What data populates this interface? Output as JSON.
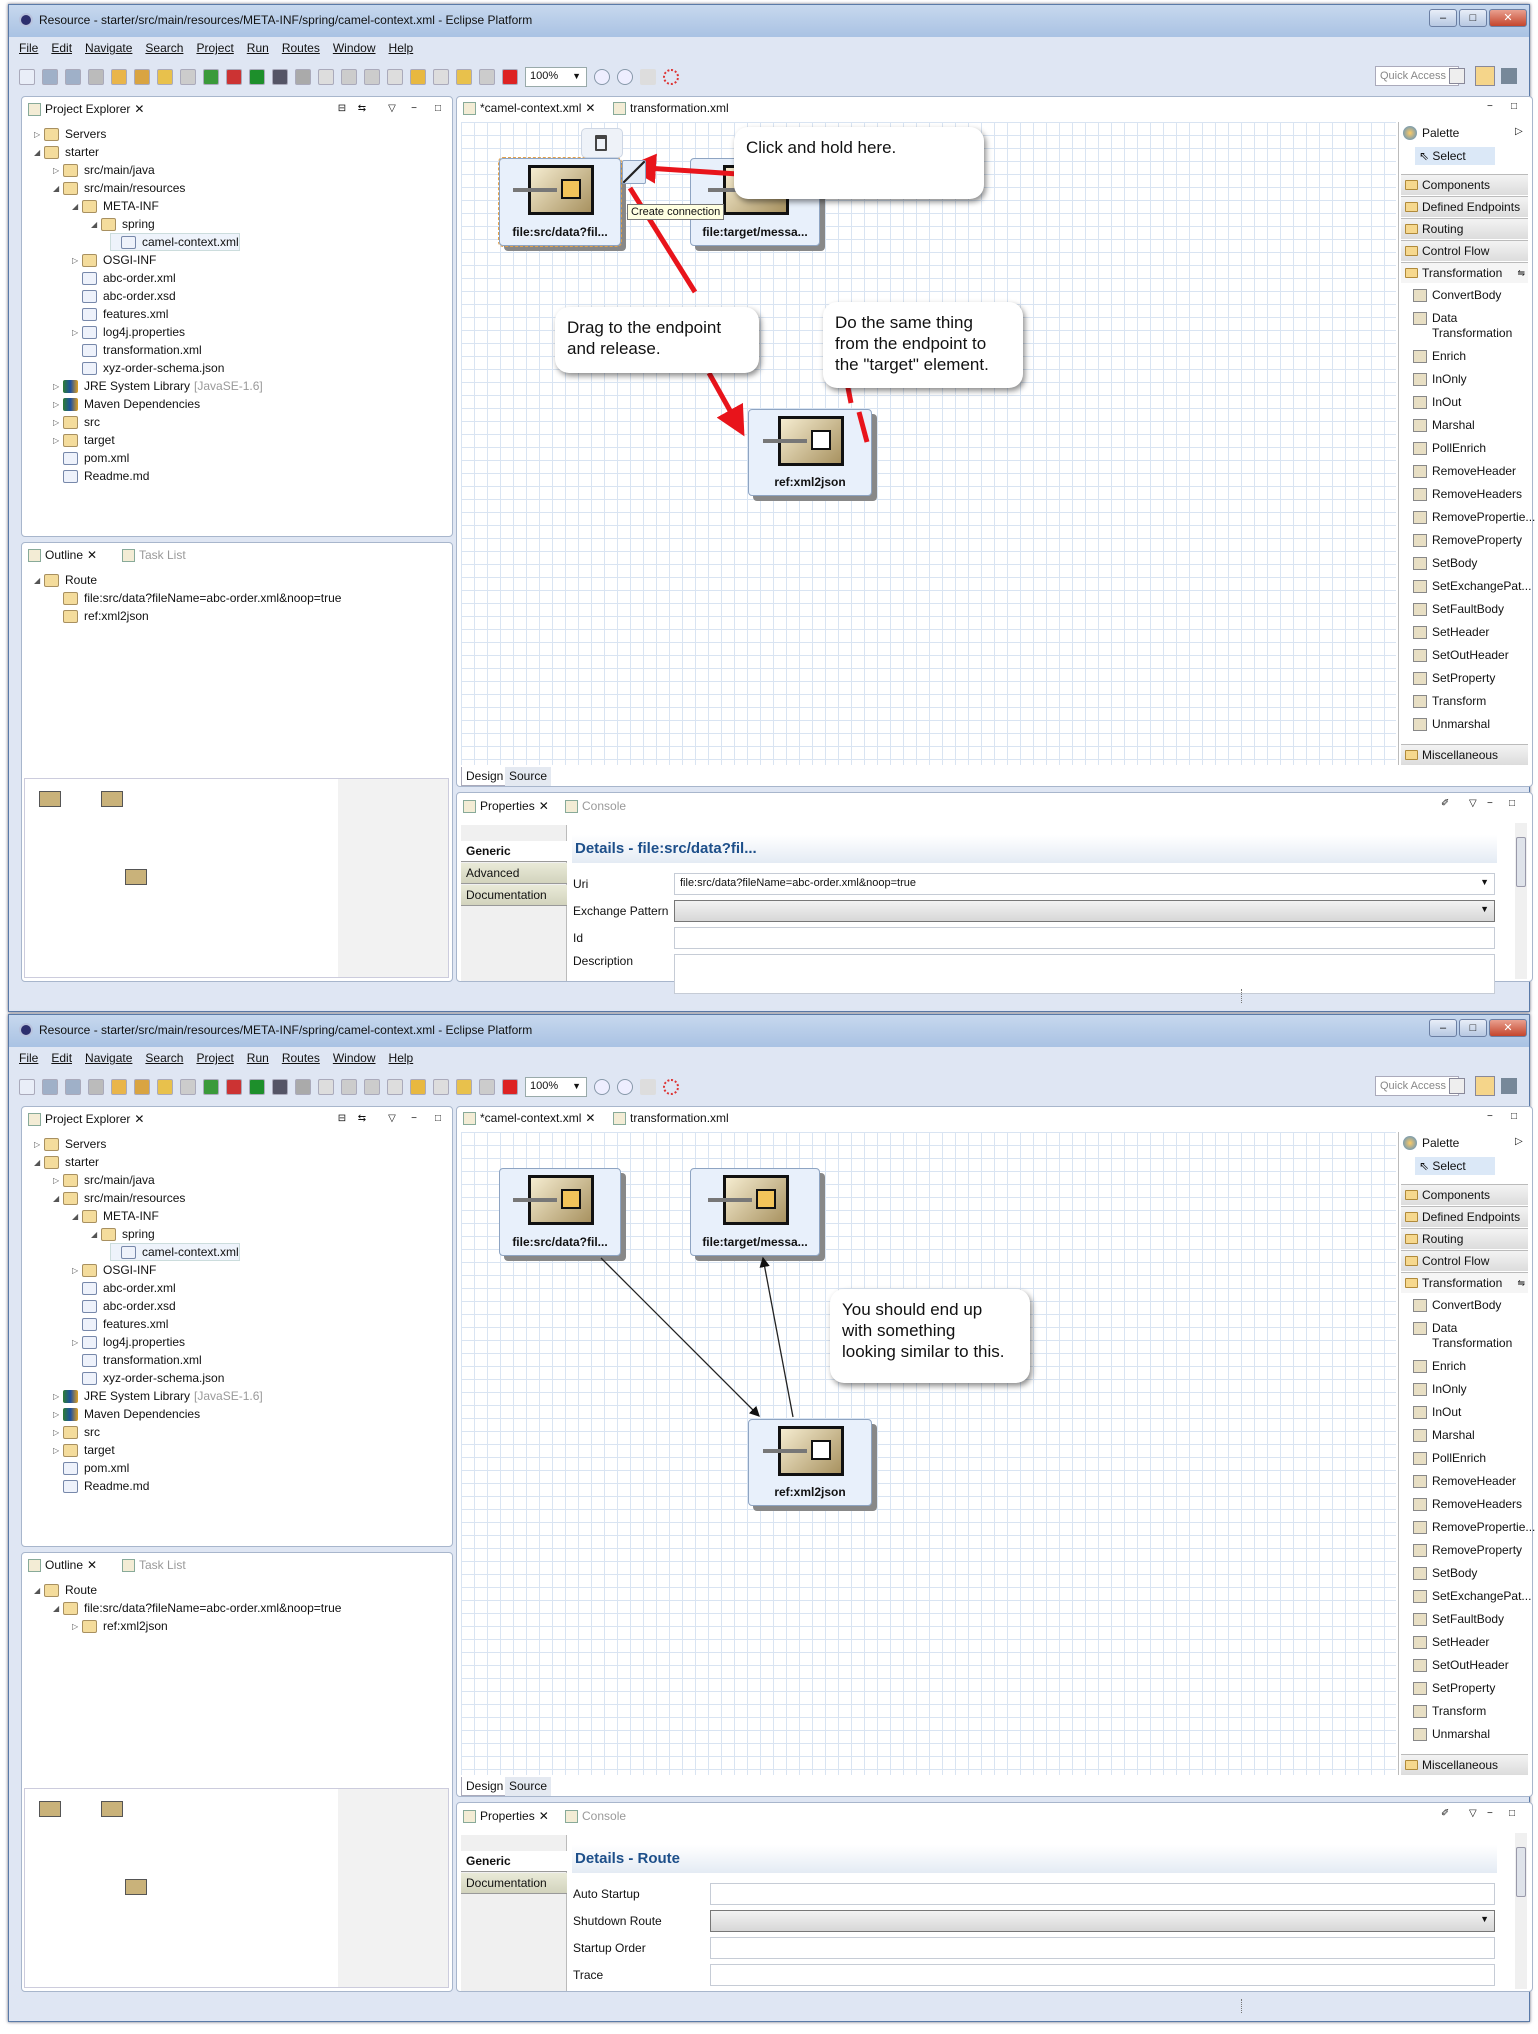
{
  "common": {
    "title": "Resource - starter/src/main/resources/META-INF/spring/camel-context.xml - Eclipse Platform",
    "window_buttons": [
      "–",
      "□",
      "✕"
    ],
    "menu": [
      "File",
      "Edit",
      "Navigate",
      "Search",
      "Project",
      "Run",
      "Routes",
      "Window",
      "Help"
    ],
    "toolbar_icons": [
      {
        "name": "new-icon",
        "color": "#e9eef8"
      },
      {
        "name": "save-icon",
        "color": "#9fb0c8"
      },
      {
        "name": "save-all-icon",
        "color": "#9fb0c8"
      },
      {
        "name": "print-icon",
        "color": "#bbb"
      },
      {
        "name": "open-icon",
        "color": "#e9b54a"
      },
      {
        "name": "brush-icon",
        "color": "#d9a441"
      },
      {
        "name": "undo-icon",
        "color": "#e8c14c"
      },
      {
        "name": "redo-icon",
        "color": "#ccc"
      },
      {
        "name": "run-server-icon",
        "color": "#3a9a3a"
      },
      {
        "name": "deploy-icon",
        "color": "#c33"
      },
      {
        "name": "run-icon",
        "color": "#1d8f2b"
      },
      {
        "name": "debug-icon",
        "color": "#556"
      },
      {
        "name": "stop-icon",
        "color": "#aaa"
      },
      {
        "name": "hand-icon",
        "color": "#ddd"
      },
      {
        "name": "next-annotation-icon",
        "color": "#ccc"
      },
      {
        "name": "prev-annotation-icon",
        "color": "#ccc"
      },
      {
        "name": "back-icon",
        "color": "#ddd"
      },
      {
        "name": "back-history-icon",
        "color": "#e8b840"
      },
      {
        "name": "forward-icon",
        "color": "#ddd"
      },
      {
        "name": "undo-edit-icon",
        "color": "#e8c14c"
      },
      {
        "name": "redo-edit-icon",
        "color": "#ccc"
      },
      {
        "name": "delete-icon",
        "color": "#d22"
      }
    ],
    "zoom_value": "100%",
    "zoom_in_icon": "zoom-in-icon",
    "quick_access": "Quick Access",
    "project_explorer": {
      "title": "Project Explorer",
      "tree": [
        {
          "label": "Servers",
          "level": 0,
          "twisty": "closed",
          "icon": "folder"
        },
        {
          "label": "starter",
          "level": 0,
          "twisty": "open",
          "icon": "project"
        },
        {
          "label": "src/main/java",
          "level": 1,
          "twisty": "closed",
          "icon": "folder"
        },
        {
          "label": "src/main/resources",
          "level": 1,
          "twisty": "open",
          "icon": "folder"
        },
        {
          "label": "META-INF",
          "level": 2,
          "twisty": "open",
          "icon": "folder"
        },
        {
          "label": "spring",
          "level": 3,
          "twisty": "open",
          "icon": "folder"
        },
        {
          "label": "camel-context.xml",
          "level": 4,
          "twisty": "",
          "icon": "file",
          "selected": true
        },
        {
          "label": "OSGI-INF",
          "level": 2,
          "twisty": "closed",
          "icon": "folder"
        },
        {
          "label": "abc-order.xml",
          "level": 2,
          "twisty": "",
          "icon": "file"
        },
        {
          "label": "abc-order.xsd",
          "level": 2,
          "twisty": "",
          "icon": "file"
        },
        {
          "label": "features.xml",
          "level": 2,
          "twisty": "",
          "icon": "file"
        },
        {
          "label": "log4j.properties",
          "level": 2,
          "twisty": "closed",
          "icon": "file"
        },
        {
          "label": "transformation.xml",
          "level": 2,
          "twisty": "",
          "icon": "file"
        },
        {
          "label": "xyz-order-schema.json",
          "level": 2,
          "twisty": "",
          "icon": "file"
        },
        {
          "label": "JRE System Library",
          "suffix": "[JavaSE-1.6]",
          "level": 1,
          "twisty": "closed",
          "icon": "lib"
        },
        {
          "label": "Maven Dependencies",
          "level": 1,
          "twisty": "closed",
          "icon": "lib"
        },
        {
          "label": "src",
          "level": 1,
          "twisty": "closed",
          "icon": "folder"
        },
        {
          "label": "target",
          "level": 1,
          "twisty": "closed",
          "icon": "folder"
        },
        {
          "label": "pom.xml",
          "level": 1,
          "twisty": "",
          "icon": "file"
        },
        {
          "label": "Readme.md",
          "level": 1,
          "twisty": "",
          "icon": "file"
        }
      ]
    },
    "outline_tab": "Outline",
    "task_list_tab": "Task List",
    "editor_tabs": [
      "*camel-context.xml",
      "transformation.xml"
    ],
    "nodes": [
      "file:src/data?fil...",
      "file:target/messa...",
      "ref:xml2json"
    ],
    "palette": {
      "title": "Palette",
      "select": "Select",
      "categories_before": [
        "Components",
        "Defined Endpoints",
        "Routing",
        "Control Flow"
      ],
      "open_category": "Transformation",
      "items": [
        "ConvertBody",
        "Data Transformation",
        "Enrich",
        "InOnly",
        "InOut",
        "Marshal",
        "PollEnrich",
        "RemoveHeader",
        "RemoveHeaders",
        "RemovePropertie...",
        "RemoveProperty",
        "SetBody",
        "SetExchangePat...",
        "SetFaultBody",
        "SetHeader",
        "SetOutHeader",
        "SetProperty",
        "Transform",
        "Unmarshal"
      ],
      "categories_after": [
        "Miscellaneous"
      ]
    },
    "bottom_tabs": [
      "Design",
      "Source"
    ],
    "properties_tab": "Properties",
    "console_tab": "Console"
  },
  "windows": [
    {
      "outline": [
        {
          "label": "Route",
          "level": 0,
          "twisty": "open"
        },
        {
          "label": "file:src/data?fileName=abc-order.xml&noop=true",
          "level": 1,
          "twisty": ""
        },
        {
          "label": "ref:xml2json",
          "level": 1,
          "twisty": ""
        }
      ],
      "tooltip": "Create connection",
      "callouts": [
        "Click and hold here.",
        "Drag to the endpoint\nand release.",
        "Do the same thing\nfrom the endpoint to\nthe \"target\" element."
      ],
      "arrow_color": "#e8141b",
      "properties": {
        "tabs": [
          "Generic",
          "Advanced",
          "Documentation"
        ],
        "header": "Details - file:src/data?fil...",
        "fields": [
          {
            "label": "Uri",
            "value": "file:src/data?fileName=abc-order.xml&noop=true",
            "type": "combo-text"
          },
          {
            "label": "Exchange Pattern",
            "value": "",
            "type": "combo"
          },
          {
            "label": "Id",
            "value": "",
            "type": "text"
          },
          {
            "label": "Description",
            "value": "",
            "type": "textarea"
          }
        ]
      }
    },
    {
      "outline": [
        {
          "label": "Route",
          "level": 0,
          "twisty": "open"
        },
        {
          "label": "file:src/data?fileName=abc-order.xml&noop=true",
          "level": 1,
          "twisty": "open"
        },
        {
          "label": "ref:xml2json",
          "level": 2,
          "twisty": "closed"
        }
      ],
      "callouts": [
        "You should end up\nwith something\nlooking similar to this."
      ],
      "properties": {
        "tabs": [
          "Generic",
          "Documentation"
        ],
        "header": "Details - Route",
        "fields": [
          {
            "label": "Auto Startup",
            "value": "",
            "type": "text"
          },
          {
            "label": "Shutdown Route",
            "value": "",
            "type": "combo"
          },
          {
            "label": "Startup Order",
            "value": "",
            "type": "text"
          },
          {
            "label": "Trace",
            "value": "",
            "type": "text"
          }
        ]
      }
    }
  ]
}
